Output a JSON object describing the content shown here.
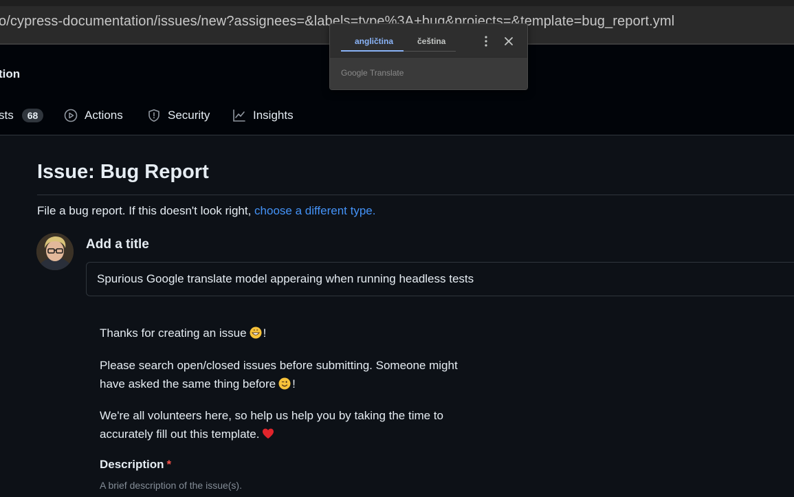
{
  "browser": {
    "url": "o/cypress-documentation/issues/new?assignees=&labels=type%3A+bug&projects=&template=bug_report.yml"
  },
  "repo": {
    "name_fragment": "tion"
  },
  "nav": {
    "tabs": [
      {
        "label": "sts",
        "count": "68",
        "icon": "pull-request-icon"
      },
      {
        "label": "Actions",
        "icon": "play-circle-icon"
      },
      {
        "label": "Security",
        "icon": "shield-icon"
      },
      {
        "label": "Insights",
        "icon": "graph-icon"
      }
    ]
  },
  "translate_popup": {
    "tabs": [
      "angličtina",
      "čeština"
    ],
    "active_tab": 0,
    "brand_google": "Google",
    "brand_translate": "Translate"
  },
  "issue": {
    "heading": "Issue: Bug Report",
    "subtitle_prefix": "File a bug report. If this doesn't look right,",
    "subtitle_link": "choose a different type.",
    "title_label": "Add a title",
    "title_value": "Spurious Google translate model apperaing when running headless tests",
    "body": {
      "p1_text": "Thanks for creating an issue",
      "p1_suffix": "!",
      "p1_emoji": "grinning-face-emoji",
      "p2_text": "Please search open/closed issues before submitting. Someone might have asked the same thing before",
      "p2_suffix": "!",
      "p2_emoji": "winking-face-emoji",
      "p3_text": "We're all volunteers here, so help us help you by taking the time to accurately fill out this template.",
      "p3_emoji": "red-heart-emoji"
    },
    "description": {
      "label": "Description",
      "required_mark": "*",
      "hint": "A brief description of the issue(s)."
    }
  },
  "colors": {
    "background": "#0d1117",
    "header_bg": "#010409",
    "link": "#4493f8",
    "required": "#f85149",
    "translate_accent": "#8ab4f8"
  }
}
